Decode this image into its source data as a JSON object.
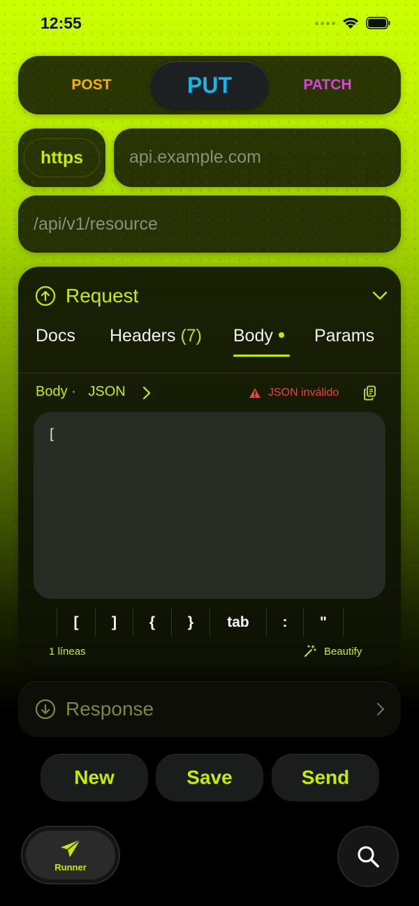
{
  "status_bar": {
    "time": "12:55"
  },
  "methods": {
    "post": "POST",
    "put": "PUT",
    "patch": "PATCH",
    "selected": "PUT"
  },
  "url": {
    "scheme": "https",
    "host_placeholder": "api.example.com",
    "path_placeholder": "/api/v1/resource"
  },
  "request": {
    "title": "Request",
    "tabs": {
      "docs": "Docs",
      "headers": "Headers",
      "headers_count": "(7)",
      "body": "Body",
      "params": "Params",
      "active": "Body"
    },
    "body_crumb": {
      "body": "Body",
      "separator": "·",
      "format": "JSON"
    },
    "warning": "JSON inválido",
    "editor_content": "[",
    "keys": [
      "[",
      "]",
      "{",
      "}",
      "tab",
      ":",
      "\""
    ],
    "lines_count": "1 líneas",
    "beautify_label": "Beautify"
  },
  "response": {
    "title": "Response"
  },
  "actions": {
    "new": "New",
    "save": "Save",
    "send": "Send"
  },
  "bottom": {
    "runner_label": "Runner"
  },
  "colors": {
    "accent": "#c5ec00",
    "post": "#f5b300",
    "put": "#1ab4e6",
    "patch": "#d945d6",
    "error": "#e8453c"
  },
  "icons": [
    "wifi-icon",
    "battery-icon",
    "arrow-up-circle-icon",
    "chevron-down-icon",
    "chevron-right-icon",
    "warning-icon",
    "copy-icon",
    "magic-wand-icon",
    "arrow-down-circle-icon",
    "paper-plane-icon",
    "search-icon"
  ]
}
